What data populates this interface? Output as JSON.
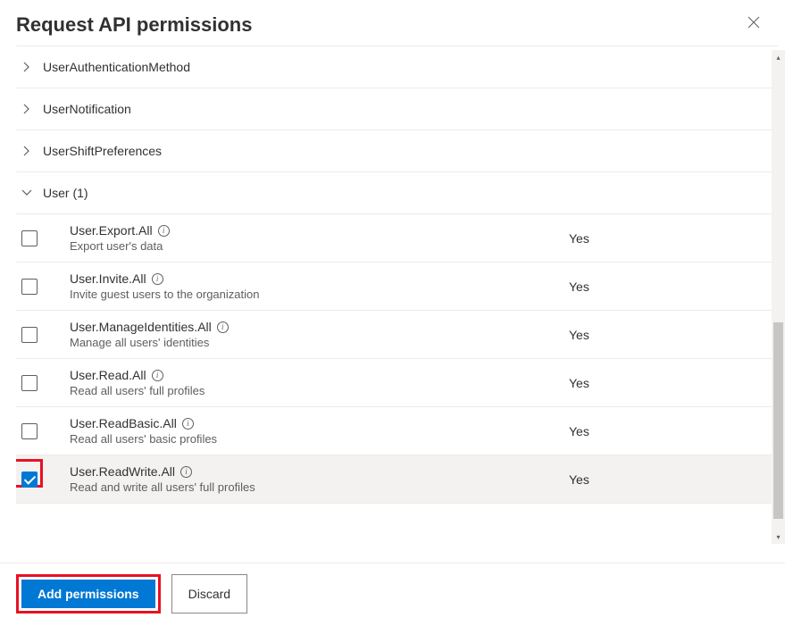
{
  "header": {
    "title": "Request API permissions"
  },
  "groups": [
    {
      "label": "UserAuthenticationMethod",
      "expanded": false
    },
    {
      "label": "UserNotification",
      "expanded": false
    },
    {
      "label": "UserShiftPreferences",
      "expanded": false
    },
    {
      "label": "User (1)",
      "expanded": true
    }
  ],
  "permissions": [
    {
      "name": "User.Export.All",
      "desc": "Export user's data",
      "admin": "Yes",
      "checked": false
    },
    {
      "name": "User.Invite.All",
      "desc": "Invite guest users to the organization",
      "admin": "Yes",
      "checked": false
    },
    {
      "name": "User.ManageIdentities.All",
      "desc": "Manage all users' identities",
      "admin": "Yes",
      "checked": false
    },
    {
      "name": "User.Read.All",
      "desc": "Read all users' full profiles",
      "admin": "Yes",
      "checked": false
    },
    {
      "name": "User.ReadBasic.All",
      "desc": "Read all users' basic profiles",
      "admin": "Yes",
      "checked": false
    },
    {
      "name": "User.ReadWrite.All",
      "desc": "Read and write all users' full profiles",
      "admin": "Yes",
      "checked": true
    }
  ],
  "footer": {
    "primary": "Add permissions",
    "secondary": "Discard"
  }
}
